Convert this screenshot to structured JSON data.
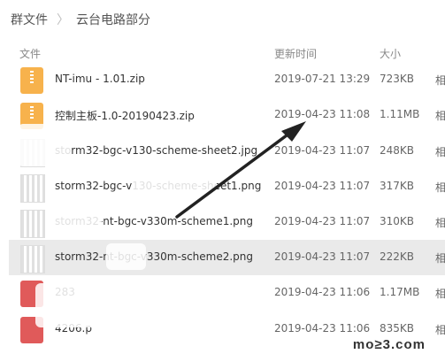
{
  "breadcrumb": {
    "root": "群文件",
    "separator": "〉",
    "current": "云台电路部分"
  },
  "columns": {
    "name": "文件",
    "date": "更新时间",
    "size": "大小"
  },
  "files": [
    {
      "name": "NT-imu - 1.01.zip",
      "date": "2019-07-21 13:29",
      "size": "723KB",
      "icon": "zip-icon"
    },
    {
      "name": "控制主板-1.0-20190423.zip",
      "date": "2019-04-23 11:08",
      "size": "1.11MB",
      "icon": "zip-icon"
    },
    {
      "name": "storm32-bgc-v130-scheme-sheet2.jpg",
      "date": "2019-04-23 11:07",
      "size": "248KB",
      "icon": "image-icon"
    },
    {
      "name": "storm32-bgc-v130-scheme-sheet1.png",
      "date": "2019-04-23 11:07",
      "size": "317KB",
      "icon": "image-icon"
    },
    {
      "name": "storm32-nt-bgc-v330m-scheme1.png",
      "date": "2019-04-23 11:07",
      "size": "310KB",
      "icon": "image-icon"
    },
    {
      "name": "storm32-nt-bgc-v330m-scheme2.png",
      "date": "2019-04-23 11:07",
      "size": "222KB",
      "icon": "image-icon"
    },
    {
      "name": "283",
      "date": "2019-04-23 11:06",
      "size": "1.17MB",
      "icon": "red-file-icon"
    },
    {
      "name": "4206.p",
      "date": "2019-04-23 11:06",
      "size": "835KB",
      "icon": "red-file-icon"
    }
  ],
  "more_indicator": "相",
  "watermark": "mo≥3.com",
  "colors": {
    "zip": "#f7b24c",
    "selected_row": "#eaeaea",
    "arrow": "#222222"
  }
}
